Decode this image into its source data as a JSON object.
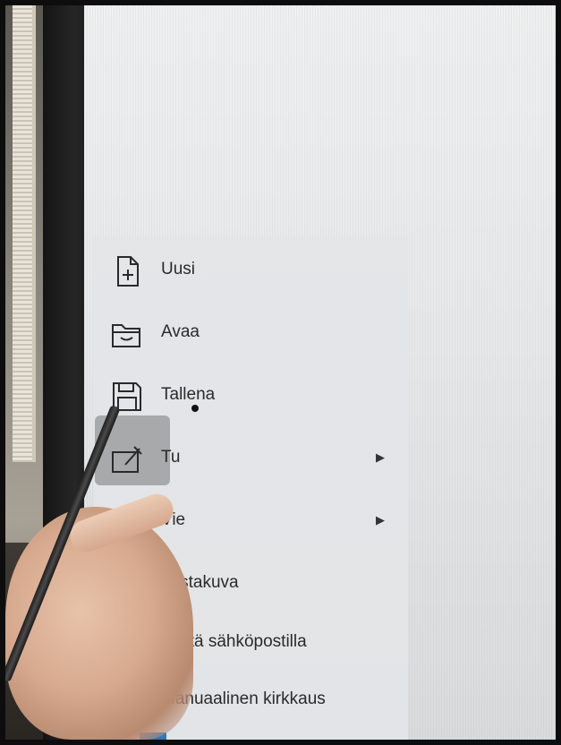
{
  "menu": {
    "items": [
      {
        "label": "Uusi",
        "icon": "new-document-icon",
        "submenu": false
      },
      {
        "label": "Avaa",
        "icon": "open-folder-icon",
        "submenu": false
      },
      {
        "label": "Tallena",
        "icon": "save-icon",
        "submenu": false
      },
      {
        "label": "Tu",
        "icon": "import-icon",
        "submenu": true
      },
      {
        "label": "Vie",
        "icon": "export-folder-icon",
        "submenu": true
      },
      {
        "label": "nustakuva",
        "icon": "background-icon",
        "submenu": false
      },
      {
        "label": "ähetä sähköpostilla",
        "icon": "mail-icon",
        "submenu": false
      },
      {
        "label": "Manuaalinen kirkkaus",
        "icon": "brightness-icon",
        "submenu": false
      }
    ],
    "submenu_arrow": "▶"
  },
  "colors": {
    "screen_bg": "#e6e8ea",
    "menu_bg": "#e3e5e7",
    "circle_accent": "#3f86c8"
  }
}
